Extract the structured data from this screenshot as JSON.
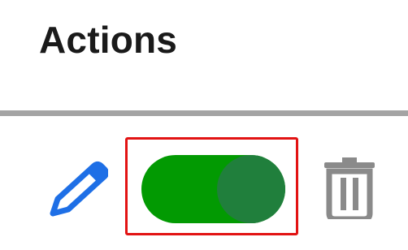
{
  "header": {
    "title": "Actions"
  },
  "row": {
    "edit_icon": "pencil-icon",
    "toggle": {
      "state": "on",
      "highlighted": true
    },
    "delete_icon": "trash-icon"
  },
  "colors": {
    "text": "#1a1a1a",
    "divider": "#a4a4a4",
    "edit_icon": "#1e6fe6",
    "toggle_track": "#029a02",
    "toggle_knob": "#207f3c",
    "highlight_frame": "#e21313",
    "delete_icon": "#8a8a8a"
  }
}
